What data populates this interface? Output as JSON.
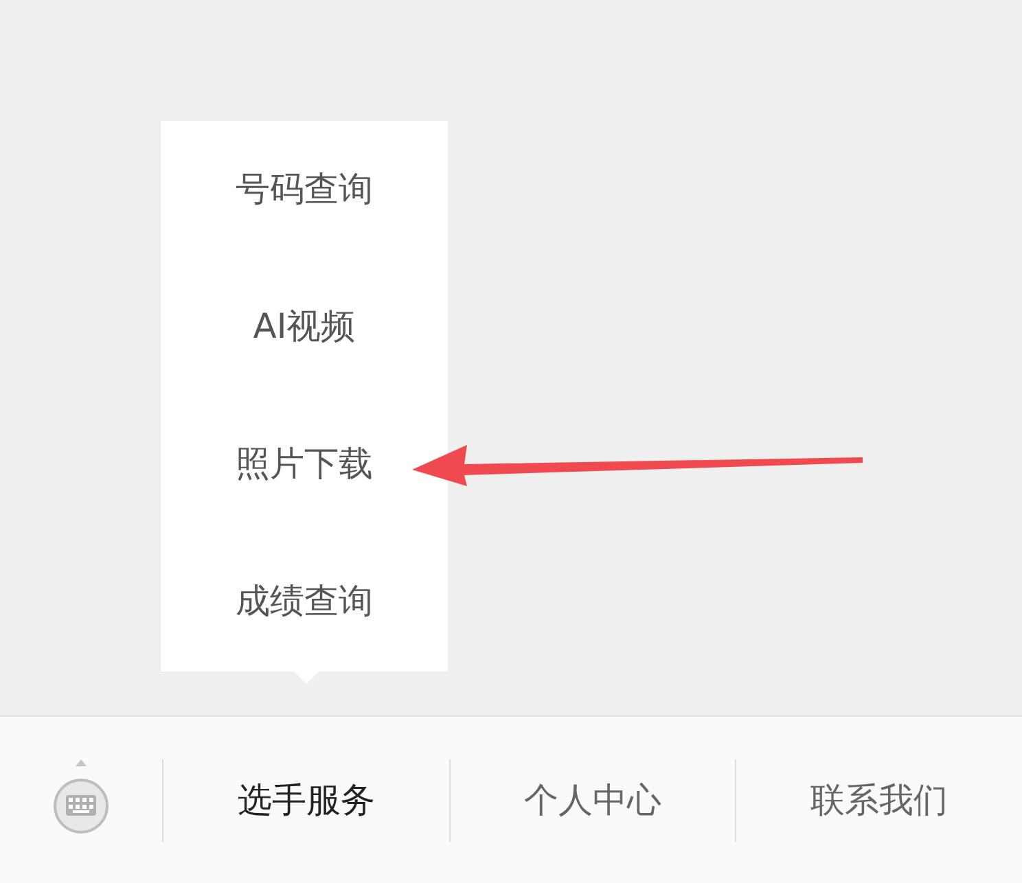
{
  "popup_menu": {
    "items": [
      {
        "label": "号码查询"
      },
      {
        "label": "AI视频"
      },
      {
        "label": "照片下载"
      },
      {
        "label": "成绩查询"
      }
    ]
  },
  "bottom_bar": {
    "tabs": [
      {
        "label": "选手服务",
        "selected": true
      },
      {
        "label": "个人中心",
        "selected": false
      },
      {
        "label": "联系我们",
        "selected": false
      }
    ]
  }
}
